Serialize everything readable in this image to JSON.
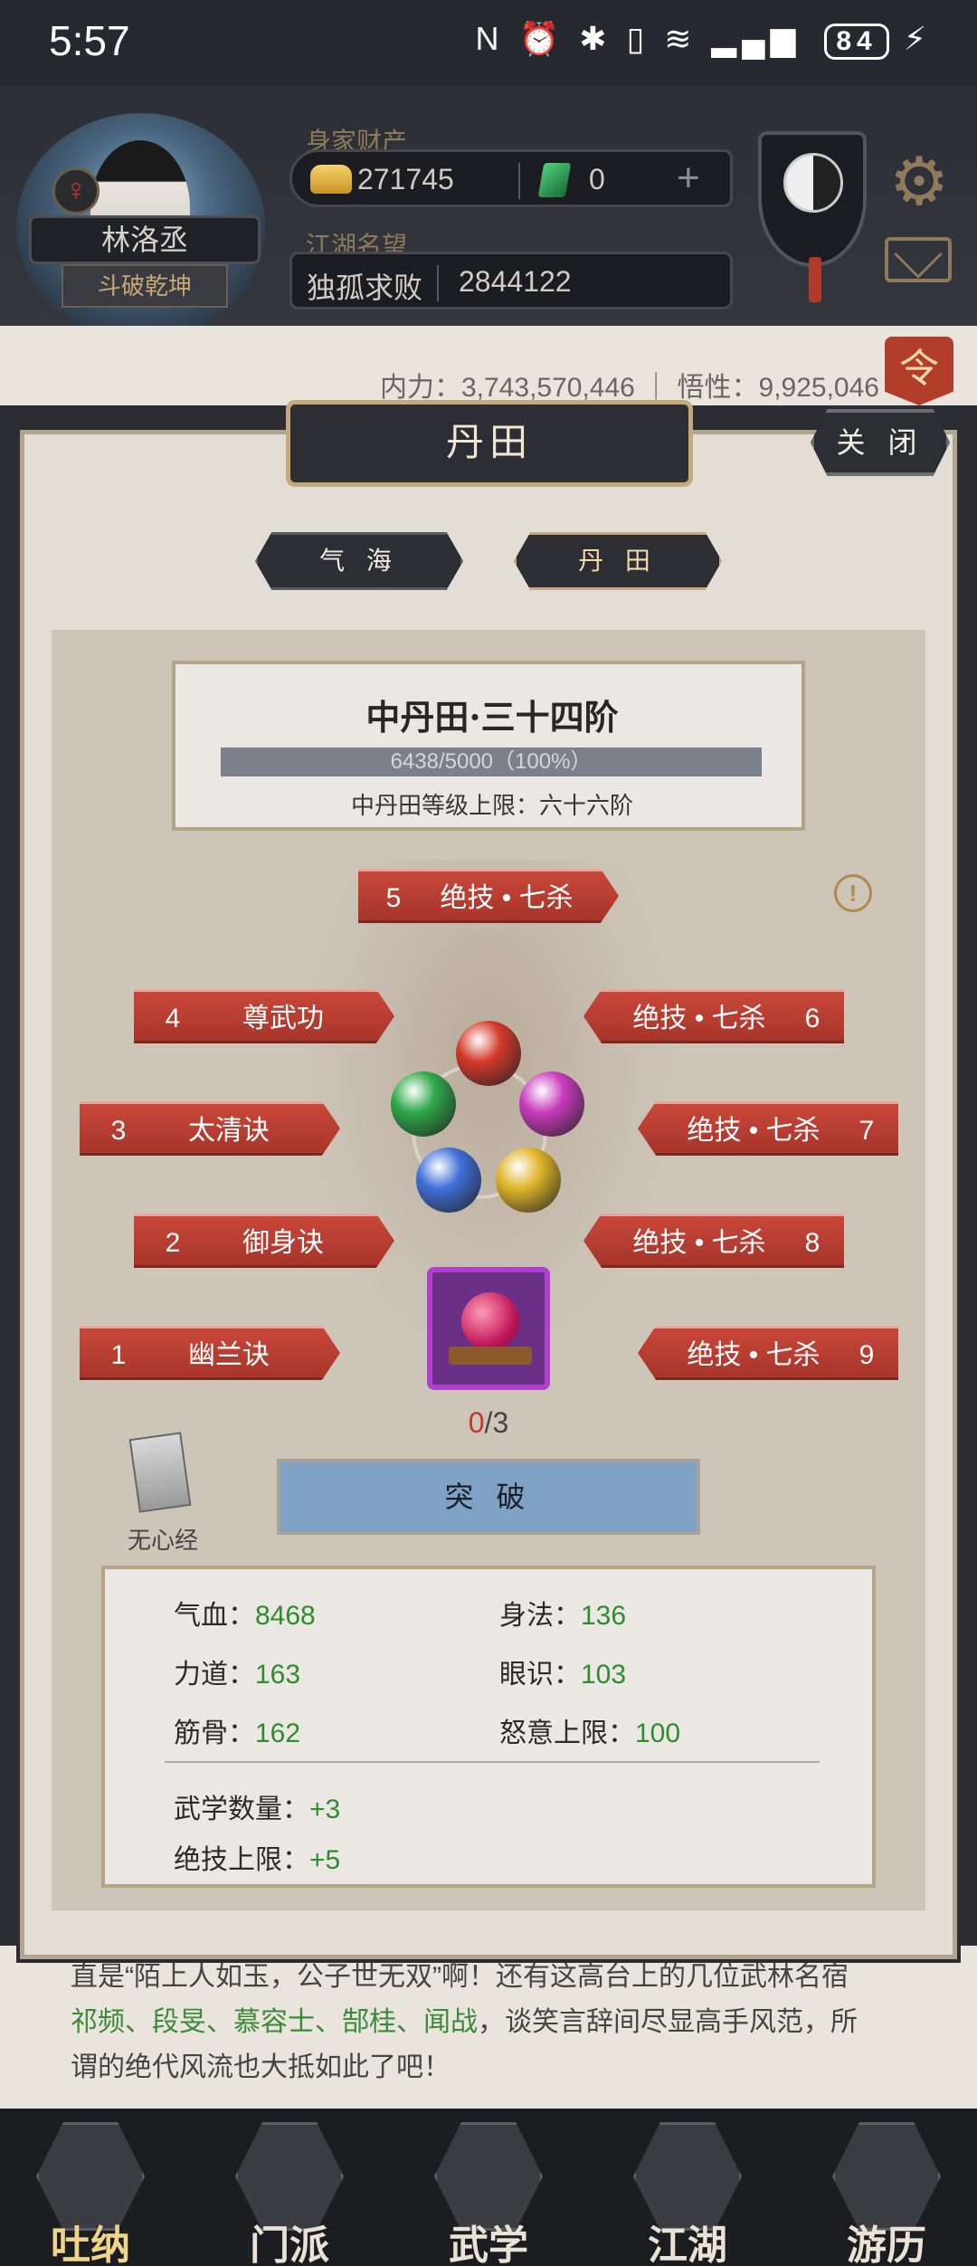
{
  "status_bar": {
    "time": "5:57",
    "icons": "N ⏰ ✱ ▯ ≋ ▂▄▆",
    "battery": "84"
  },
  "player": {
    "name": "林洛丞",
    "title": "斗破乾坤"
  },
  "wealth": {
    "label": "身家财产",
    "gold": "271745",
    "gems": "0",
    "plus": "+"
  },
  "fame": {
    "label": "江湖名望",
    "title": "独孤求败",
    "value": "2844122"
  },
  "top_stats": {
    "text": "内力：3,743,570,446 ｜ 悟性：9,925,046",
    "order_label": "令"
  },
  "modal": {
    "title": "丹田",
    "close_label": "关 闭",
    "tabs": [
      {
        "label": "气 海"
      },
      {
        "label": "丹 田"
      }
    ],
    "dantian": {
      "name": "中丹田·三十四阶",
      "progress_text": "6438/5000（100%）",
      "progress_fraction": 1.0,
      "limit": "中丹田等级上限：六十六阶"
    },
    "info_icon": "!",
    "skills": [
      {
        "num": "5",
        "name": "绝技 • 七杀"
      },
      {
        "num": "4",
        "name": "尊武功"
      },
      {
        "num": "6",
        "name": "绝技 • 七杀"
      },
      {
        "num": "3",
        "name": "太清诀"
      },
      {
        "num": "7",
        "name": "绝技 • 七杀"
      },
      {
        "num": "2",
        "name": "御身诀"
      },
      {
        "num": "8",
        "name": "绝技 • 七杀"
      },
      {
        "num": "1",
        "name": "幽兰诀"
      },
      {
        "num": "9",
        "name": "绝技 • 七杀"
      }
    ],
    "orb_colors": [
      "#d43a2a",
      "#2fa84a",
      "#c93bbd",
      "#3f6fd8",
      "#e0b52a"
    ],
    "item_count_current": "0",
    "item_count_total": "/3",
    "book_label": "无心经",
    "break_label": "突 破",
    "stats": {
      "qixue_label": "气血：",
      "qixue": "8468",
      "shenfa_label": "身法：",
      "shenfa": "136",
      "lidao_label": "力道：",
      "lidao": "163",
      "yanshi_label": "眼识：",
      "yanshi": "103",
      "jingu_label": "筋骨：",
      "jingu": "162",
      "nuyi_label": "怒意上限：",
      "nuyi": "100",
      "wuxue_label": "武学数量：",
      "wuxue": "+3",
      "jueji_label": "绝技上限：",
      "jueji": "+5"
    }
  },
  "story": {
    "line1": "直是“陌上人如玉，公子世无双”啊！还有这高台上的几位武林名宿",
    "line2_names": "祁频、段旻、慕容士、郜桂、闻战",
    "line2_rest": "，谈笑言辞间尽显高手风范，所",
    "line3": "谓的绝代风流也大抵如此了吧！"
  },
  "nav": [
    {
      "label": "吐纳"
    },
    {
      "label": "门派"
    },
    {
      "label": "武学"
    },
    {
      "label": "江湖"
    },
    {
      "label": "游历"
    }
  ]
}
